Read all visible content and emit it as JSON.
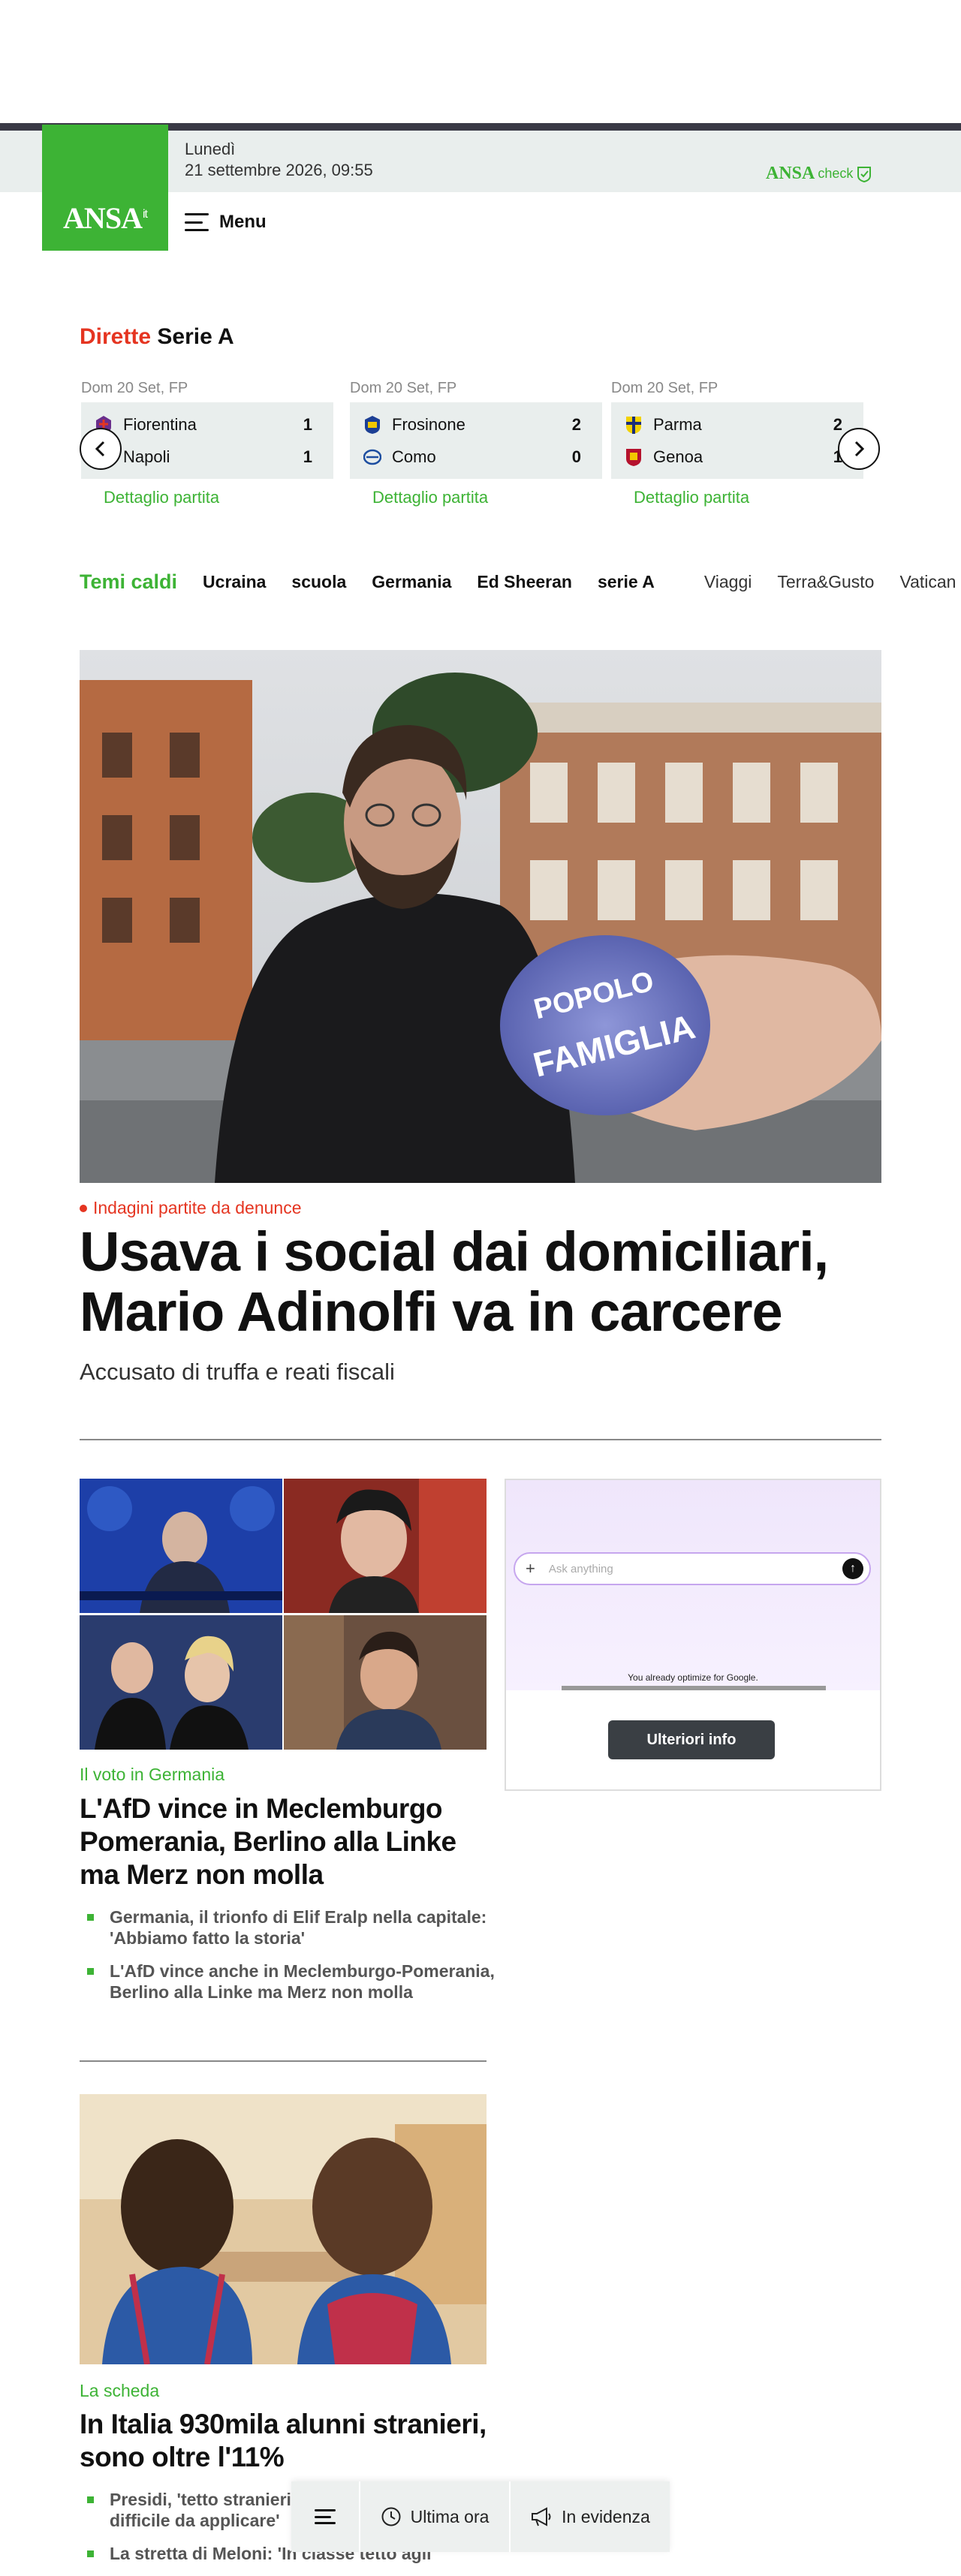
{
  "header": {
    "logo_text": "ANSA",
    "logo_suffix": "it",
    "date_day": "Lunedì",
    "date_full": "21 settembre 2026, 09:55",
    "ansacheck_brand": "ANSA",
    "ansacheck_sub": "check",
    "menu_label": "Menu"
  },
  "live": {
    "title_red": "Dirette",
    "title_black": "Serie A",
    "matches": [
      {
        "date": "Dom 20 Set, FP",
        "home": "Fiorentina",
        "home_score": "1",
        "away": "Napoli",
        "away_score": "1",
        "link": "Dettaglio partita"
      },
      {
        "date": "Dom 20 Set, FP",
        "home": "Frosinone",
        "home_score": "2",
        "away": "Como",
        "away_score": "0",
        "link": "Dettaglio partita"
      },
      {
        "date": "Dom 20 Set, FP",
        "home": "Parma",
        "home_score": "2",
        "away": "Genoa",
        "away_score": "1",
        "link": "Dettaglio partita"
      }
    ]
  },
  "trending": {
    "label": "Temi caldi",
    "items": [
      "Ucraina",
      "scuola",
      "Germania",
      "Ed Sheeran",
      "serie A"
    ],
    "sections": [
      "Viaggi",
      "Terra&Gusto",
      "Vatican"
    ]
  },
  "hero": {
    "kicker": "Indagini partite da denunce",
    "title": "Usava i social dai domiciliari, Mario Adinolfi va in carcere",
    "subtitle": "Accusato di truffa e reati fiscali",
    "badge_line1": "POPOLO",
    "badge_line2": "FAMIGLIA"
  },
  "story2": {
    "kicker": "Il voto in Germania",
    "title": "L'AfD vince in Meclemburgo Pomerania, Berlino alla Linke ma Merz non molla",
    "bullets": [
      "Germania, il trionfo di Elif Eralp nella capitale: 'Abbiamo fatto la storia'",
      "L'AfD vince anche in Meclemburgo-Pomerania, Berlino alla Linke ma Merz non molla"
    ]
  },
  "ad": {
    "ask_placeholder": "Ask anything",
    "tagline": "You already optimize for Google.",
    "button": "Ulteriori info"
  },
  "story3": {
    "kicker": "La scheda",
    "title": "In Italia 930mila alunni stranieri, sono oltre l'11%",
    "bullets": [
      "Presidi, 'tetto stranieri difficile da applicare'",
      "La stretta di Meloni: 'In classe tetto agli"
    ]
  },
  "bottom_nav": {
    "latest": "Ultima ora",
    "featured": "In evidenza"
  },
  "colors": {
    "brand_green": "#3db335",
    "accent_red": "#e53521",
    "dark_bar": "#3a3a46",
    "light_band": "#e9eeed"
  }
}
